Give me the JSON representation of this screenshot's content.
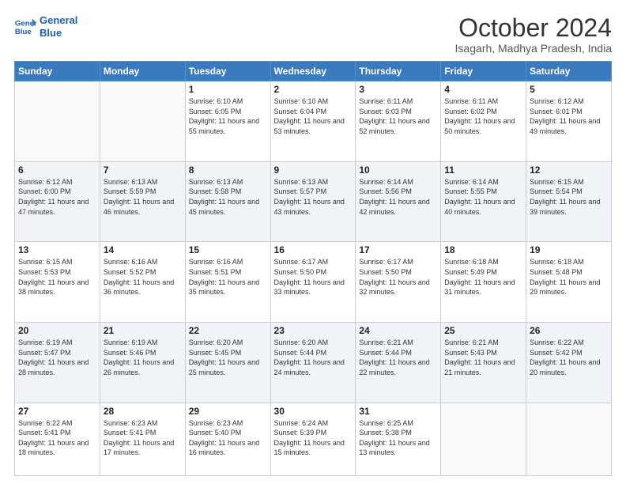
{
  "header": {
    "logo_line1": "General",
    "logo_line2": "Blue",
    "month_title": "October 2024",
    "subtitle": "Isagarh, Madhya Pradesh, India"
  },
  "days_of_week": [
    "Sunday",
    "Monday",
    "Tuesday",
    "Wednesday",
    "Thursday",
    "Friday",
    "Saturday"
  ],
  "weeks": [
    [
      {
        "day": "",
        "empty": true
      },
      {
        "day": "",
        "empty": true
      },
      {
        "day": "1",
        "sunrise": "Sunrise: 6:10 AM",
        "sunset": "Sunset: 6:05 PM",
        "daylight": "Daylight: 11 hours and 55 minutes."
      },
      {
        "day": "2",
        "sunrise": "Sunrise: 6:10 AM",
        "sunset": "Sunset: 6:04 PM",
        "daylight": "Daylight: 11 hours and 53 minutes."
      },
      {
        "day": "3",
        "sunrise": "Sunrise: 6:11 AM",
        "sunset": "Sunset: 6:03 PM",
        "daylight": "Daylight: 11 hours and 52 minutes."
      },
      {
        "day": "4",
        "sunrise": "Sunrise: 6:11 AM",
        "sunset": "Sunset: 6:02 PM",
        "daylight": "Daylight: 11 hours and 50 minutes."
      },
      {
        "day": "5",
        "sunrise": "Sunrise: 6:12 AM",
        "sunset": "Sunset: 6:01 PM",
        "daylight": "Daylight: 11 hours and 49 minutes."
      }
    ],
    [
      {
        "day": "6",
        "sunrise": "Sunrise: 6:12 AM",
        "sunset": "Sunset: 6:00 PM",
        "daylight": "Daylight: 11 hours and 47 minutes."
      },
      {
        "day": "7",
        "sunrise": "Sunrise: 6:13 AM",
        "sunset": "Sunset: 5:59 PM",
        "daylight": "Daylight: 11 hours and 46 minutes."
      },
      {
        "day": "8",
        "sunrise": "Sunrise: 6:13 AM",
        "sunset": "Sunset: 5:58 PM",
        "daylight": "Daylight: 11 hours and 45 minutes."
      },
      {
        "day": "9",
        "sunrise": "Sunrise: 6:13 AM",
        "sunset": "Sunset: 5:57 PM",
        "daylight": "Daylight: 11 hours and 43 minutes."
      },
      {
        "day": "10",
        "sunrise": "Sunrise: 6:14 AM",
        "sunset": "Sunset: 5:56 PM",
        "daylight": "Daylight: 11 hours and 42 minutes."
      },
      {
        "day": "11",
        "sunrise": "Sunrise: 6:14 AM",
        "sunset": "Sunset: 5:55 PM",
        "daylight": "Daylight: 11 hours and 40 minutes."
      },
      {
        "day": "12",
        "sunrise": "Sunrise: 6:15 AM",
        "sunset": "Sunset: 5:54 PM",
        "daylight": "Daylight: 11 hours and 39 minutes."
      }
    ],
    [
      {
        "day": "13",
        "sunrise": "Sunrise: 6:15 AM",
        "sunset": "Sunset: 5:53 PM",
        "daylight": "Daylight: 11 hours and 38 minutes."
      },
      {
        "day": "14",
        "sunrise": "Sunrise: 6:16 AM",
        "sunset": "Sunset: 5:52 PM",
        "daylight": "Daylight: 11 hours and 36 minutes."
      },
      {
        "day": "15",
        "sunrise": "Sunrise: 6:16 AM",
        "sunset": "Sunset: 5:51 PM",
        "daylight": "Daylight: 11 hours and 35 minutes."
      },
      {
        "day": "16",
        "sunrise": "Sunrise: 6:17 AM",
        "sunset": "Sunset: 5:50 PM",
        "daylight": "Daylight: 11 hours and 33 minutes."
      },
      {
        "day": "17",
        "sunrise": "Sunrise: 6:17 AM",
        "sunset": "Sunset: 5:50 PM",
        "daylight": "Daylight: 11 hours and 32 minutes."
      },
      {
        "day": "18",
        "sunrise": "Sunrise: 6:18 AM",
        "sunset": "Sunset: 5:49 PM",
        "daylight": "Daylight: 11 hours and 31 minutes."
      },
      {
        "day": "19",
        "sunrise": "Sunrise: 6:18 AM",
        "sunset": "Sunset: 5:48 PM",
        "daylight": "Daylight: 11 hours and 29 minutes."
      }
    ],
    [
      {
        "day": "20",
        "sunrise": "Sunrise: 6:19 AM",
        "sunset": "Sunset: 5:47 PM",
        "daylight": "Daylight: 11 hours and 28 minutes."
      },
      {
        "day": "21",
        "sunrise": "Sunrise: 6:19 AM",
        "sunset": "Sunset: 5:46 PM",
        "daylight": "Daylight: 11 hours and 26 minutes."
      },
      {
        "day": "22",
        "sunrise": "Sunrise: 6:20 AM",
        "sunset": "Sunset: 5:45 PM",
        "daylight": "Daylight: 11 hours and 25 minutes."
      },
      {
        "day": "23",
        "sunrise": "Sunrise: 6:20 AM",
        "sunset": "Sunset: 5:44 PM",
        "daylight": "Daylight: 11 hours and 24 minutes."
      },
      {
        "day": "24",
        "sunrise": "Sunrise: 6:21 AM",
        "sunset": "Sunset: 5:44 PM",
        "daylight": "Daylight: 11 hours and 22 minutes."
      },
      {
        "day": "25",
        "sunrise": "Sunrise: 6:21 AM",
        "sunset": "Sunset: 5:43 PM",
        "daylight": "Daylight: 11 hours and 21 minutes."
      },
      {
        "day": "26",
        "sunrise": "Sunrise: 6:22 AM",
        "sunset": "Sunset: 5:42 PM",
        "daylight": "Daylight: 11 hours and 20 minutes."
      }
    ],
    [
      {
        "day": "27",
        "sunrise": "Sunrise: 6:22 AM",
        "sunset": "Sunset: 5:41 PM",
        "daylight": "Daylight: 11 hours and 18 minutes."
      },
      {
        "day": "28",
        "sunrise": "Sunrise: 6:23 AM",
        "sunset": "Sunset: 5:41 PM",
        "daylight": "Daylight: 11 hours and 17 minutes."
      },
      {
        "day": "29",
        "sunrise": "Sunrise: 6:23 AM",
        "sunset": "Sunset: 5:40 PM",
        "daylight": "Daylight: 11 hours and 16 minutes."
      },
      {
        "day": "30",
        "sunrise": "Sunrise: 6:24 AM",
        "sunset": "Sunset: 5:39 PM",
        "daylight": "Daylight: 11 hours and 15 minutes."
      },
      {
        "day": "31",
        "sunrise": "Sunrise: 6:25 AM",
        "sunset": "Sunset: 5:38 PM",
        "daylight": "Daylight: 11 hours and 13 minutes."
      },
      {
        "day": "",
        "empty": true
      },
      {
        "day": "",
        "empty": true
      }
    ]
  ]
}
